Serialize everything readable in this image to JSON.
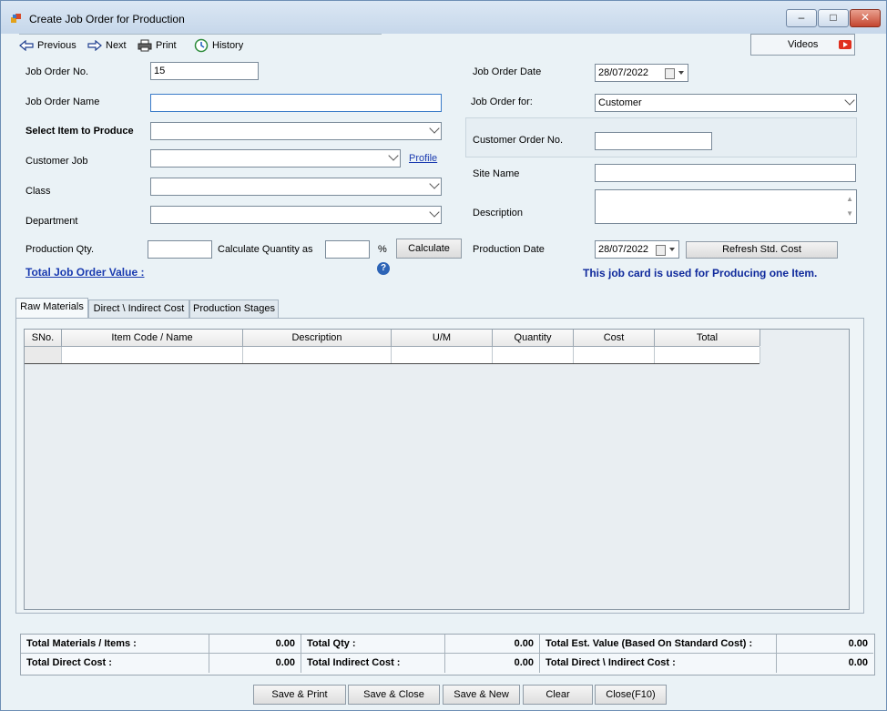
{
  "window": {
    "title": "Create Job Order for Production"
  },
  "toolbar": {
    "previous": "Previous",
    "next": "Next",
    "print": "Print",
    "history": "History",
    "videos": "Videos"
  },
  "form": {
    "job_order_no_label": "Job Order No.",
    "job_order_no_value": "15",
    "job_order_name_label": "Job Order Name",
    "select_item_label": "Select Item to Produce",
    "customer_job_label": "Customer Job",
    "profile_link": "Profile",
    "class_label": "Class",
    "department_label": "Department",
    "production_qty_label": "Production Qty.",
    "calc_qty_label": "Calculate Quantity as",
    "percent": "%",
    "calculate_button": "Calculate",
    "total_value_link": "Total Job Order Value :",
    "job_order_date_label": "Job Order Date",
    "job_order_date_value": "28/07/2022",
    "job_order_for_label": "Job Order for:",
    "job_order_for_value": "Customer",
    "customer_order_no_label": "Customer Order No.",
    "site_name_label": "Site Name",
    "description_label": "Description",
    "production_date_label": "Production Date",
    "production_date_value": "28/07/2022",
    "refresh_button": "Refresh Std. Cost",
    "note": "This job card is used for Producing one Item."
  },
  "tabs": [
    {
      "label": "Raw Materials"
    },
    {
      "label": "Direct \\ Indirect Cost"
    },
    {
      "label": "Production Stages"
    }
  ],
  "grid": {
    "columns": [
      "SNo.",
      "Item Code / Name",
      "Description",
      "U/M",
      "Quantity",
      "Cost",
      "Total"
    ]
  },
  "totals": {
    "materials_label": "Total Materials / Items :",
    "materials_value": "0.00",
    "qty_label": "Total Qty :",
    "qty_value": "0.00",
    "est_label": "Total Est. Value  (Based On Standard Cost) :",
    "est_value": "0.00",
    "direct_label": "Total Direct Cost :",
    "direct_value": "0.00",
    "indirect_label": "Total Indirect Cost :",
    "indirect_value": "0.00",
    "di_label": "Total Direct \\ Indirect Cost  :",
    "di_value": "0.00"
  },
  "buttons": {
    "save_print": "Save & Print",
    "save_close": "Save & Close",
    "save_new": "Save & New",
    "clear": "Clear",
    "close": "Close(F10)"
  }
}
